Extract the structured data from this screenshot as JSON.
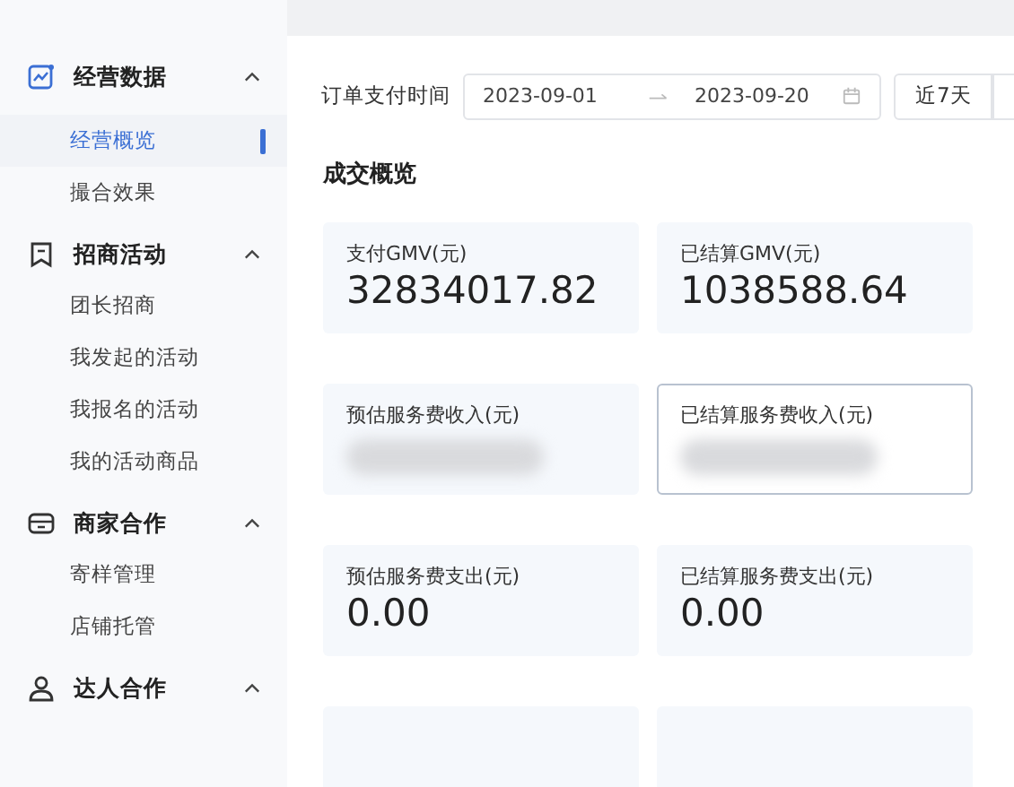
{
  "sidebar": {
    "groups": [
      {
        "title": "经营数据",
        "expanded": true,
        "items": [
          {
            "label": "经营概览",
            "selected": true
          },
          {
            "label": "撮合效果",
            "selected": false
          }
        ]
      },
      {
        "title": "招商活动",
        "expanded": true,
        "items": [
          {
            "label": "团长招商",
            "selected": false
          },
          {
            "label": "我发起的活动",
            "selected": false
          },
          {
            "label": "我报名的活动",
            "selected": false
          },
          {
            "label": "我的活动商品",
            "selected": false
          }
        ]
      },
      {
        "title": "商家合作",
        "expanded": true,
        "items": [
          {
            "label": "寄样管理",
            "selected": false
          },
          {
            "label": "店铺托管",
            "selected": false
          }
        ]
      },
      {
        "title": "达人合作",
        "expanded": true
      }
    ]
  },
  "filter": {
    "label": "订单支付时间",
    "start": "2023-09-01",
    "end": "2023-09-20",
    "quick_ranges": [
      {
        "label": "近7天",
        "selected": false
      }
    ]
  },
  "section": {
    "title": "成交概览",
    "cards": [
      {
        "label": "支付GMV(元)",
        "value": "32834017.82",
        "redacted": false,
        "highlighted": false
      },
      {
        "label": "已结算GMV(元)",
        "value": "1038588.64",
        "redacted": false,
        "highlighted": false
      },
      {
        "label": "预估服务费收入(元)",
        "redacted": true,
        "highlighted": false
      },
      {
        "label": "已结算服务费收入(元)",
        "redacted": true,
        "highlighted": true
      },
      {
        "label": "预估服务费支出(元)",
        "value": "0.00",
        "redacted": false,
        "highlighted": false
      },
      {
        "label": "已结算服务费支出(元)",
        "value": "0.00",
        "redacted": false,
        "highlighted": false
      },
      {
        "highlighted": false
      },
      {
        "highlighted": false
      }
    ]
  }
}
